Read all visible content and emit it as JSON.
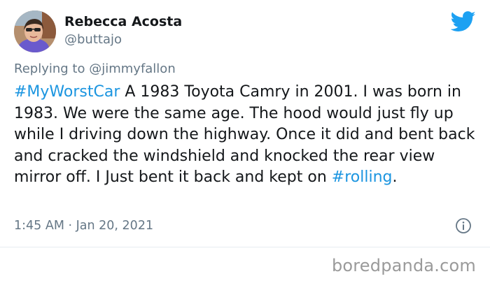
{
  "author": {
    "name": "Rebecca Acosta",
    "handle": "@buttajo"
  },
  "reply": {
    "prefix": "Replying to",
    "mention": "@jimmyfallon"
  },
  "tweet": {
    "hashtag1": "#MyWorstCar",
    "body": " A 1983 Toyota Camry in 2001. I was born in 1983. We were the same age. The hood would just fly up while I driving down the highway. Once it did and bent back and cracked the windshield and knocked the rear view mirror off. I Just bent it back and kept on ",
    "hashtag2": "#rolling",
    "end": "."
  },
  "meta": {
    "timestamp": "1:45 AM · Jan 20, 2021"
  },
  "watermark": "boredpanda.com",
  "icons": {
    "brand": "twitter-bird-icon",
    "info": "info-icon"
  },
  "colors": {
    "link": "#1b95e0",
    "twitter": "#1da1f2",
    "secondary_text": "#657786"
  }
}
